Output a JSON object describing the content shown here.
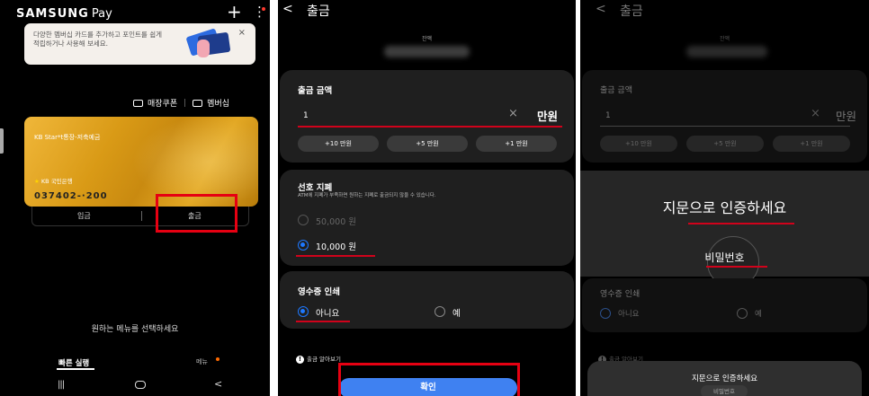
{
  "panel1": {
    "brand": "SAMSUNG",
    "brand_suffix": "Pay",
    "promo_text": "다양한 멤버십 카드를 추가하고 포인트를 쉽게 적립하거나 사용해 보세요.",
    "promo_close": "×",
    "coupon_label": "매장쿠폰",
    "membership_label": "멤버십",
    "card": {
      "title": "KB Star*t통장-저축예금",
      "bank": "KB 국민은행",
      "number": "037402-·200"
    },
    "actions": {
      "deposit": "입금",
      "withdraw": "출금"
    },
    "select_prompt": "원하는 메뉴를 선택하세요",
    "quick_run": "빠른 실행",
    "menu": "메뉴",
    "nav": {
      "back": "<"
    }
  },
  "panel2": {
    "back": "<",
    "title": "출금",
    "balance_label": "잔액",
    "amount": {
      "title": "출금 금액",
      "value": "1",
      "clear": "×",
      "unit": "만원",
      "chips": [
        "+10 만원",
        "+5 만원",
        "+1 만원"
      ]
    },
    "preferred": {
      "title": "선호 지폐",
      "desc": "ATM에 지폐가 부족하면 원하는 지폐로 출금되지 않을 수 있습니다.",
      "options": [
        {
          "label": "50,000 원",
          "selected": false,
          "enabled": false
        },
        {
          "label": "10,000 원",
          "selected": true,
          "enabled": true
        }
      ]
    },
    "receipt": {
      "title": "영수증 인쇄",
      "options": [
        {
          "label": "아니요",
          "selected": true
        },
        {
          "label": "예",
          "selected": false
        }
      ]
    },
    "info": "출금 알아보기",
    "confirm": "확인"
  },
  "panel3": {
    "back": "<",
    "title": "출금",
    "balance_label": "잔액",
    "amount_title": "출금 금액",
    "amount_value": "1",
    "clear": "×",
    "unit": "만원",
    "chips": [
      "+10 만원",
      "+5 만원",
      "+1 만원"
    ],
    "fingerprint_prompt": "지문으로 인증하세요",
    "password_button": "비밀번호",
    "receipt_title": "영수증 인쇄",
    "receipt_options": [
      "아니요",
      "예"
    ],
    "info": "출금 알아보기",
    "sheet_title": "지문으로 인증하세요",
    "sheet_password": "비밀번호"
  },
  "colors": {
    "highlight_red": "#e60012",
    "accent_blue": "#3f81f1",
    "card_gold": "#d99a16"
  }
}
